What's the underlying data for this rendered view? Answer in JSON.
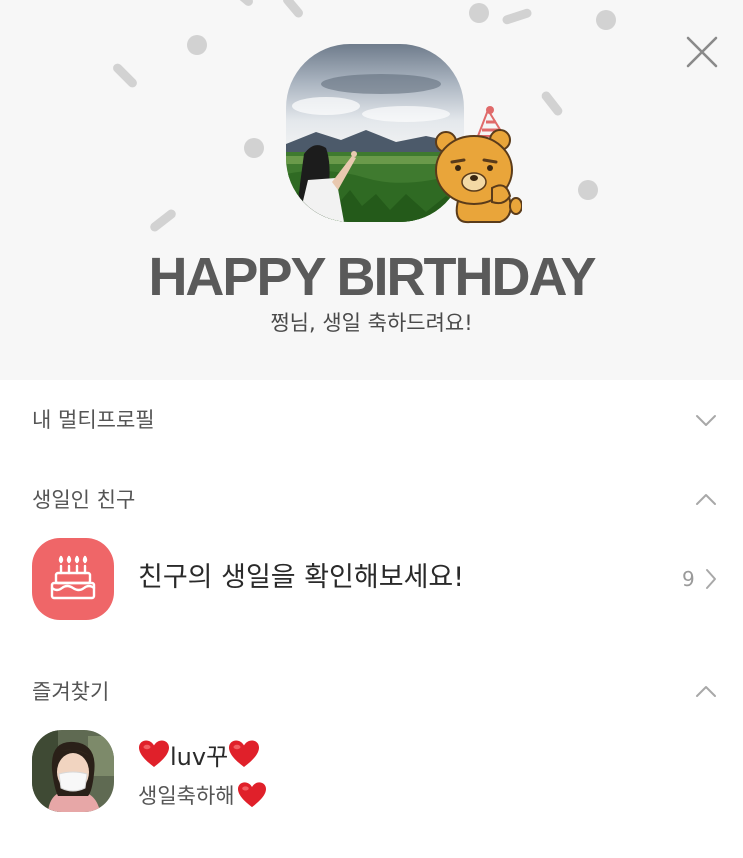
{
  "hero": {
    "title": "HAPPY BIRTHDAY",
    "subtitle": "쩡님, 생일 축하드려요!"
  },
  "sections": {
    "multiprofile": {
      "label": "내 멀티프로필"
    },
    "birthday_friends": {
      "label": "생일인 친구",
      "item": {
        "text": "친구의 생일을 확인해보세요!",
        "count": "9"
      }
    },
    "favorites": {
      "label": "즐겨찾기",
      "items": [
        {
          "name": "luv꾸",
          "status": "생일축하해"
        }
      ]
    }
  },
  "icons": {
    "close": "close-icon",
    "chevron_down": "chevron-down-icon",
    "chevron_up": "chevron-up-icon",
    "chevron_right": "chevron-right-icon",
    "cake": "cake-icon",
    "heart": "red-heart-icon"
  },
  "colors": {
    "hero_bg": "#f7f7f7",
    "confetti": "#d2d2d2",
    "cake_tile": "#ef6668",
    "heart": "#e0202a",
    "title": "#5a5a5a"
  }
}
